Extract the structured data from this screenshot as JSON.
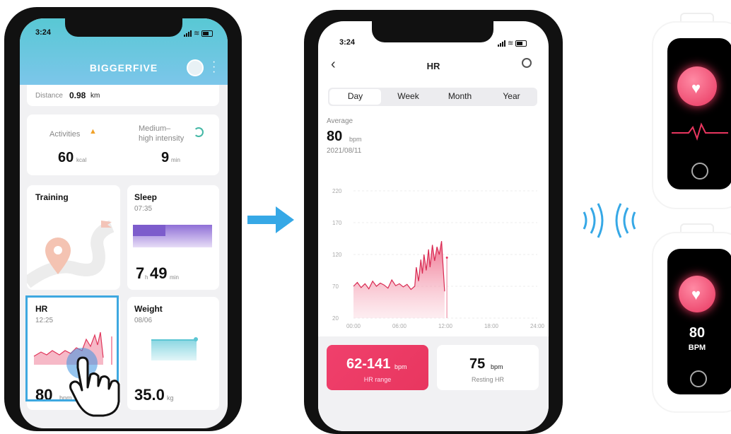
{
  "phone1": {
    "time": "3:24",
    "app_title": "BIGGERFIVE",
    "distance_label": "Distance",
    "distance_value": "0.98",
    "distance_unit": "km",
    "activities_label": "Activities",
    "activities_value": "60",
    "activities_unit": "kcal",
    "intensity_label_1": "Medium–",
    "intensity_label_2": "high intensity",
    "intensity_value": "9",
    "intensity_unit": "min",
    "training_label": "Training",
    "sleep_label": "Sleep",
    "sleep_time": "07:35",
    "sleep_hours": "7",
    "sleep_h_unit": "h",
    "sleep_minutes": "49",
    "sleep_min_unit": "min",
    "hr_label": "HR",
    "hr_time": "12:25",
    "hr_value": "80",
    "hr_unit": "bpm",
    "weight_label": "Weight",
    "weight_date": "08/06",
    "weight_value": "35.0",
    "weight_unit": "kg"
  },
  "phone2": {
    "time": "3:24",
    "title": "HR",
    "tabs": [
      "Day",
      "Week",
      "Month",
      "Year"
    ],
    "active_tab": "Day",
    "average_label": "Average",
    "average_value": "80",
    "average_unit": "bpm",
    "date": "2021/08/11",
    "range_value": "62-141",
    "range_unit": "bpm",
    "range_label": "HR range",
    "resting_value": "75",
    "resting_unit": "bpm",
    "resting_label": "Resting HR"
  },
  "band2": {
    "value": "80",
    "unit": "BPM"
  },
  "colors": {
    "header_teal": "#5fcbd6",
    "header_blue": "#72c3ea",
    "accent_pink": "#e8365f",
    "sleep_purple": "#8e6fd4",
    "weight_teal": "#6fd0dc",
    "arrow_blue": "#36a8e6",
    "highlight_blue": "#3ea8e0"
  },
  "chart_data": {
    "type": "area",
    "y_ticks": [
      "220",
      "170",
      "120",
      "70",
      "20"
    ],
    "x_ticks": [
      "00:00",
      "06:00",
      "12:00",
      "18:00",
      "24:00"
    ],
    "ylim": [
      20,
      220
    ],
    "x_hours": [
      0,
      0.5,
      1,
      1.5,
      2,
      2.5,
      3,
      3.5,
      4,
      4.5,
      5,
      5.5,
      6,
      6.5,
      7,
      7.5,
      8,
      8.2,
      8.5,
      8.8,
      9,
      9.2,
      9.5,
      9.8,
      10,
      10.3,
      10.6,
      10.9,
      11.2,
      11.5,
      11.9
    ],
    "values": [
      70,
      76,
      68,
      74,
      66,
      78,
      70,
      75,
      72,
      67,
      80,
      71,
      74,
      69,
      73,
      65,
      70,
      100,
      78,
      112,
      90,
      120,
      95,
      128,
      100,
      135,
      110,
      132,
      120,
      141,
      62
    ],
    "spike_hour": 12.2,
    "spike_value": 115
  }
}
